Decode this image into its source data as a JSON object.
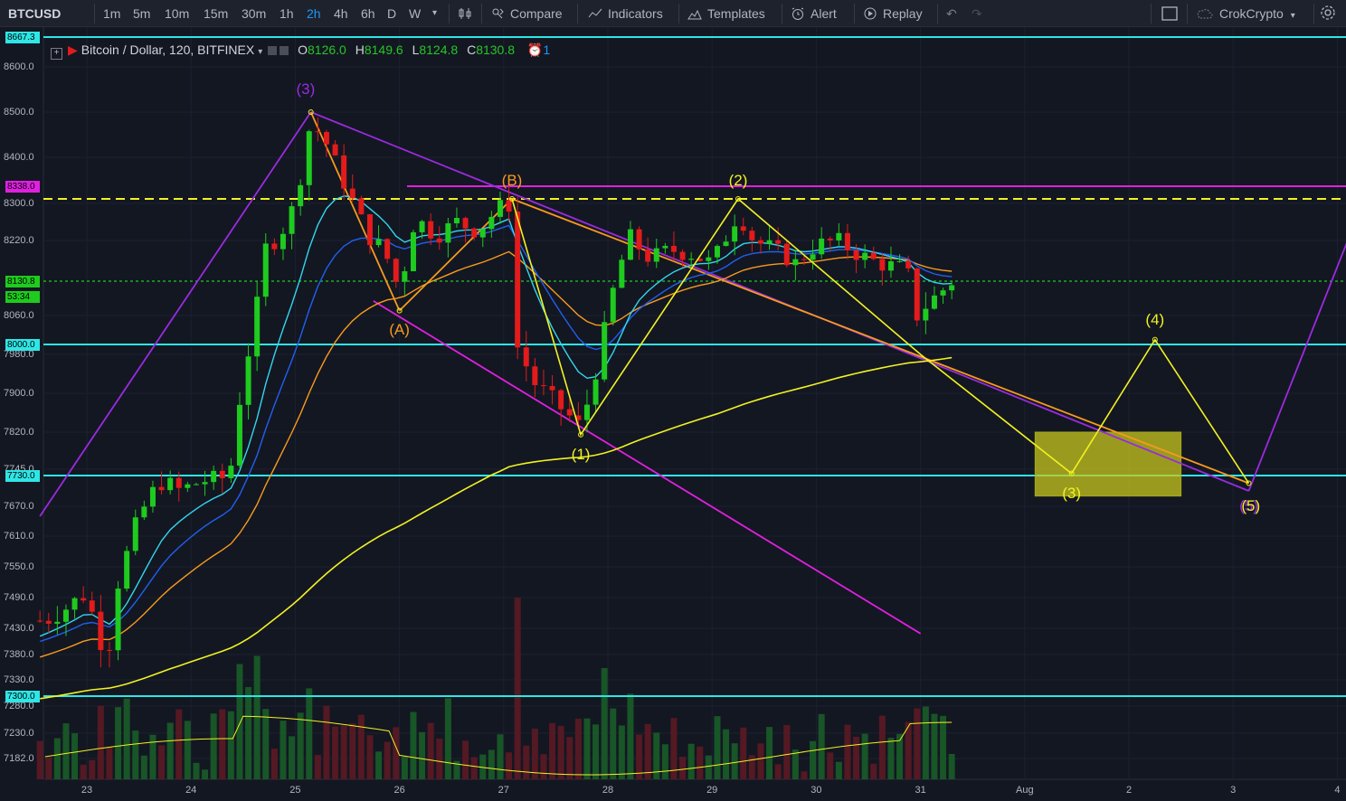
{
  "toolbar": {
    "symbol": "BTCUSD",
    "intervals": [
      "1m",
      "5m",
      "10m",
      "15m",
      "30m",
      "1h",
      "2h",
      "4h",
      "6h",
      "D",
      "W"
    ],
    "active_interval": "2h",
    "compare_label": "Compare",
    "indicators_label": "Indicators",
    "templates_label": "Templates",
    "alert_label": "Alert",
    "replay_label": "Replay",
    "user_label": "CrokCrypto"
  },
  "legend": {
    "title": "Bitcoin / Dollar, 120, BITFINEX",
    "open_key": "O",
    "open": "8126.0",
    "high_key": "H",
    "high": "8149.6",
    "low_key": "L",
    "low": "8124.8",
    "close_key": "C",
    "close": "8130.8",
    "alert_count": "1"
  },
  "colors": {
    "bg": "#131722",
    "up": "#1ecb1e",
    "down": "#e31b1b",
    "cyan": "#2ee6e6",
    "magenta": "#e020e0",
    "purple": "#9a2be0",
    "yellow": "#f2f221",
    "orange": "#f79a1e",
    "ema_cyan": "#33d6ee",
    "ema_blue": "#2060f0",
    "zone": "#c8c81e"
  },
  "price_axis": {
    "ticks": [
      "8600.0",
      "8500.0",
      "8400.0",
      "8300.0",
      "8220.0",
      "8060.0",
      "7980.0",
      "7900.0",
      "7820.0",
      "7745.0",
      "7670.0",
      "7610.0",
      "7550.0",
      "7490.0",
      "7430.0",
      "7380.0",
      "7330.0",
      "7280.0",
      "7230.0",
      "7182.0"
    ],
    "tags": [
      {
        "label": "8667.3",
        "color": "#2ee6e6"
      },
      {
        "label": "8338.0",
        "color": "#e020e0"
      },
      {
        "label": "8130.8",
        "color": "#1ecb1e"
      },
      {
        "label": "53:34",
        "color": "#1ecb1e"
      },
      {
        "label": "8000.0",
        "color": "#2ee6e6"
      },
      {
        "label": "7730.0",
        "color": "#2ee6e6"
      },
      {
        "label": "7300.0",
        "color": "#2ee6e6"
      }
    ]
  },
  "time_axis": [
    "23",
    "24",
    "25",
    "26",
    "27",
    "28",
    "29",
    "30",
    "31",
    "Aug",
    "2",
    "3",
    "4"
  ],
  "wave_labels": [
    "(3)",
    "(A)",
    "(B)",
    "(1)",
    "(2)",
    "(4)",
    "(3)",
    "(5)",
    "(5)"
  ],
  "chart_data": {
    "type": "candlestick",
    "symbol": "BTCUSD",
    "exchange": "BITFINEX",
    "interval": "120",
    "ylim": [
      7150,
      8680
    ],
    "horizontal_levels": [
      8667.3,
      8338.0,
      8310.0,
      8130.8,
      8000.0,
      7730.0,
      7300.0
    ],
    "target_zone": {
      "from_day": 32.1,
      "to_day": 33.5,
      "high": 7820,
      "low": 7690
    },
    "wave_points": [
      {
        "label": "(3)",
        "day": 25.15,
        "price": 8500
      },
      {
        "label": "(A)",
        "day": 26.0,
        "price": 8070
      },
      {
        "label": "(B)",
        "day": 27.08,
        "price": 8310
      },
      {
        "label": "(1)",
        "day": 27.74,
        "price": 7815
      },
      {
        "label": "(2)",
        "day": 29.25,
        "price": 8310
      },
      {
        "label": "(3)",
        "day": 32.45,
        "price": 7735
      },
      {
        "label": "(4)",
        "day": 33.25,
        "price": 8010
      },
      {
        "label": "(5)",
        "day": 34.15,
        "price": 7715
      }
    ],
    "close_path": [
      [
        22.6,
        7445
      ],
      [
        22.8,
        7470
      ],
      [
        23.0,
        7500
      ],
      [
        23.1,
        7420
      ],
      [
        23.2,
        7380
      ],
      [
        23.3,
        7520
      ],
      [
        23.5,
        7650
      ],
      [
        23.7,
        7720
      ],
      [
        23.9,
        7700
      ],
      [
        24.1,
        7720
      ],
      [
        24.3,
        7725
      ],
      [
        24.4,
        7760
      ],
      [
        24.5,
        7950
      ],
      [
        24.6,
        8020
      ],
      [
        24.7,
        8200
      ],
      [
        24.85,
        8230
      ],
      [
        25.0,
        8300
      ],
      [
        25.15,
        8480
      ],
      [
        25.3,
        8430
      ],
      [
        25.5,
        8330
      ],
      [
        25.7,
        8230
      ],
      [
        25.85,
        8200
      ],
      [
        26.0,
        8110
      ],
      [
        26.15,
        8270
      ],
      [
        26.35,
        8230
      ],
      [
        26.55,
        8260
      ],
      [
        26.75,
        8240
      ],
      [
        26.95,
        8290
      ],
      [
        27.08,
        8300
      ],
      [
        27.12,
        8000
      ],
      [
        27.3,
        7920
      ],
      [
        27.5,
        7880
      ],
      [
        27.74,
        7830
      ],
      [
        27.9,
        7960
      ],
      [
        28.05,
        8110
      ],
      [
        28.2,
        8230
      ],
      [
        28.4,
        8180
      ],
      [
        28.6,
        8200
      ],
      [
        28.8,
        8190
      ],
      [
        29.0,
        8170
      ],
      [
        29.25,
        8280
      ],
      [
        29.4,
        8220
      ],
      [
        29.6,
        8200
      ],
      [
        29.8,
        8170
      ],
      [
        30.0,
        8210
      ],
      [
        30.2,
        8220
      ],
      [
        30.4,
        8190
      ],
      [
        30.6,
        8170
      ],
      [
        30.8,
        8160
      ],
      [
        30.95,
        8130
      ],
      [
        31.0,
        7920
      ],
      [
        31.05,
        8080
      ],
      [
        31.2,
        8110
      ],
      [
        31.3,
        8130
      ]
    ]
  }
}
